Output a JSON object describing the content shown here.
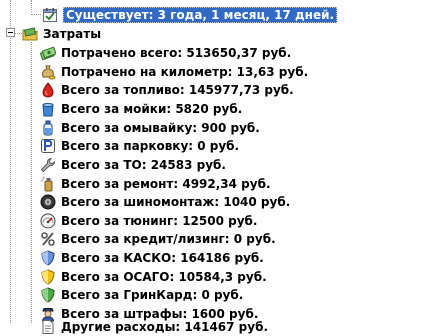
{
  "tree": {
    "top_item": {
      "label": "Существует: 3 года, 1 месяц, 17 дней.",
      "icon": "calendar-icon"
    },
    "group": {
      "label": "Затраты",
      "icon": "money-folder-icon"
    },
    "items": [
      {
        "label": "Потрачено всего: 513650,37 руб.",
        "icon": "money-bills-icon"
      },
      {
        "label": "Потрачено на километр: 13,63 руб.",
        "icon": "money-bag-icon"
      },
      {
        "label": "Всего за топливо: 145977,73 руб.",
        "icon": "fuel-drop-icon"
      },
      {
        "label": "Всего за мойки: 5820 руб.",
        "icon": "water-bucket-icon"
      },
      {
        "label": "Всего за омывайку: 900 руб.",
        "icon": "washer-bottle-icon"
      },
      {
        "label": "Всего за парковку: 0 руб.",
        "icon": "parking-icon"
      },
      {
        "label": "Всего за ТО: 24583 руб.",
        "icon": "wrench-icon"
      },
      {
        "label": "Всего за ремонт: 4992,34 руб.",
        "icon": "spray-can-icon"
      },
      {
        "label": "Всего за шиномонтаж: 1040 руб.",
        "icon": "tire-icon"
      },
      {
        "label": "Всего за тюнинг: 12500 руб.",
        "icon": "speedometer-icon"
      },
      {
        "label": "Всего за кредит/лизинг: 0 руб.",
        "icon": "percent-icon"
      },
      {
        "label": "Всего за КАСКО: 164186 руб.",
        "icon": "shield-blue-icon"
      },
      {
        "label": "Всего за ОСАГО: 10584,3 руб.",
        "icon": "shield-yellow-icon"
      },
      {
        "label": "Всего за ГринКард: 0 руб.",
        "icon": "shield-green-icon"
      },
      {
        "label": "Всего за штрафы: 1600 руб.",
        "icon": "police-officer-icon"
      },
      {
        "label": "Другие расходы: 141467 руб.",
        "icon": "document-icon"
      }
    ]
  },
  "colors": {
    "selection": "#316ac5",
    "selection_text": "#ffffff",
    "tree_lines": "#9a9a9a"
  }
}
